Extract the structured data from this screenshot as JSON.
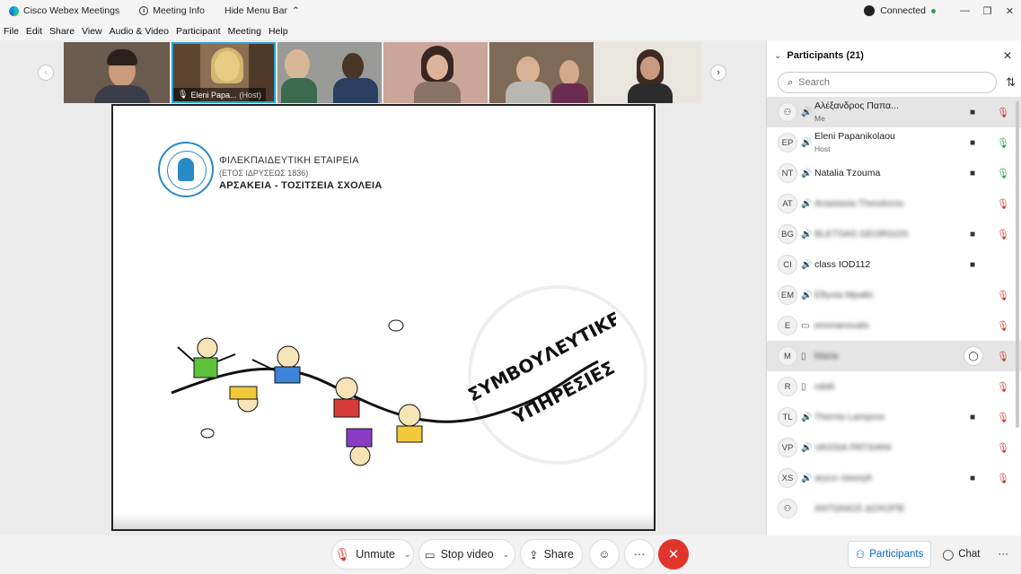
{
  "titlebar": {
    "app_title": "Cisco Webex Meetings",
    "meeting_info": "Meeting Info",
    "hide_menu": "Hide Menu Bar",
    "status": "Connected",
    "minimize": "—",
    "restore": "❐",
    "close": "✕"
  },
  "menu": [
    "File",
    "Edit",
    "Share",
    "View",
    "Audio & Video",
    "Participant",
    "Meeting",
    "Help"
  ],
  "strip": {
    "prev": "‹",
    "next": "›",
    "host_label_name": "Eleni Papa...",
    "host_label_role": "(Host)"
  },
  "slide": {
    "org_line1": "ΦΙΛΕΚΠΑΙΔΕΥΤΙΚΗ ΕΤΑΙΡΕΙΑ",
    "org_line2": "(ΕΤΟΣ ΙΔΡΥΣΕΩΣ 1836)",
    "org_line3": "ΑΡΣΑΚΕΙΑ - ΤΟΣΙΤΣΕΙΑ ΣΧΟΛΕΙΑ",
    "banner_line1": "ΣΥΜΒΟΥΛΕΥΤΙΚΕΣ",
    "banner_line2": "ΥΠΗΡΕΣΙΕΣ"
  },
  "controls": {
    "unmute": "Unmute",
    "stop_video": "Stop video",
    "share": "Share",
    "more": "···",
    "end": "✕",
    "participants": "Participants",
    "chat": "Chat",
    "overflow": "···"
  },
  "panel": {
    "title": "Participants (21)",
    "search_placeholder": "Search",
    "participants": [
      {
        "initials": "",
        "name": "Αλέξανδρος Παπα...",
        "sub": "Me",
        "video": true,
        "mic": "muted",
        "blurred": false,
        "highlight": true,
        "status": "audio"
      },
      {
        "initials": "EP",
        "name": "Eleni Papanikolaou",
        "sub": "Host",
        "video": true,
        "mic": "on",
        "blurred": false,
        "highlight": false,
        "status": "audio"
      },
      {
        "initials": "NT",
        "name": "Natalia Tzouma",
        "sub": "",
        "video": true,
        "mic": "on",
        "blurred": false,
        "highlight": false,
        "status": "audio"
      },
      {
        "initials": "AT",
        "name": "Anastasia Theodorou",
        "sub": "",
        "video": false,
        "mic": "muted",
        "blurred": true,
        "highlight": false,
        "status": "audio"
      },
      {
        "initials": "BG",
        "name": "BLETSAS GEORGOS",
        "sub": "",
        "video": true,
        "mic": "muted",
        "blurred": true,
        "highlight": false,
        "status": "audio"
      },
      {
        "initials": "CI",
        "name": "class IOD112",
        "sub": "",
        "video": true,
        "mic": "",
        "blurred": false,
        "highlight": false,
        "status": "audio"
      },
      {
        "initials": "EM",
        "name": "Eftyxia Mpallo",
        "sub": "",
        "video": false,
        "mic": "muted",
        "blurred": true,
        "highlight": false,
        "status": "audio"
      },
      {
        "initials": "E",
        "name": "emmanoualo",
        "sub": "",
        "video": false,
        "mic": "muted",
        "blurred": true,
        "highlight": false,
        "status": "screen"
      },
      {
        "initials": "M",
        "name": "Maria",
        "sub": "",
        "video": false,
        "mic": "chat",
        "blurred": true,
        "highlight": true,
        "status": "phone"
      },
      {
        "initials": "R",
        "name": "ralali",
        "sub": "",
        "video": false,
        "mic": "muted",
        "blurred": true,
        "highlight": false,
        "status": "phone"
      },
      {
        "initials": "TL",
        "name": "Themis Lampros",
        "sub": "",
        "video": true,
        "mic": "muted",
        "blurred": true,
        "highlight": false,
        "status": "audio"
      },
      {
        "initials": "VP",
        "name": "VASSIA PATSIANI",
        "sub": "",
        "video": false,
        "mic": "muted",
        "blurred": true,
        "highlight": false,
        "status": "audio"
      },
      {
        "initials": "XS",
        "name": "aryco ctasoyli",
        "sub": "",
        "video": true,
        "mic": "muted",
        "blurred": true,
        "highlight": false,
        "status": "audio"
      },
      {
        "initials": "",
        "name": "ΑΝΤΩΝΙΟΣ ΔΟΧΟΠΕ",
        "sub": "",
        "video": false,
        "mic": "",
        "blurred": true,
        "highlight": false,
        "status": ""
      }
    ]
  },
  "colors": {
    "accent": "#0a62c9",
    "end_call": "#e1352c",
    "muted": "#d43a2c",
    "mic_on": "#27a64a",
    "connected": "#27a64a"
  }
}
